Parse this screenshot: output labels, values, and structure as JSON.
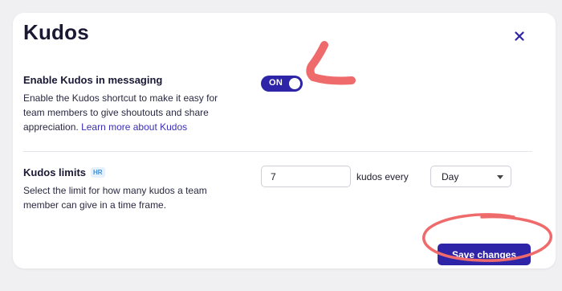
{
  "modal": {
    "title": "Kudos",
    "close_icon": "close-icon"
  },
  "messaging": {
    "heading": "Enable Kudos in messaging",
    "description": "Enable the Kudos shortcut to make it easy for team members to give shoutouts and share appreciation.",
    "link": "Learn more about Kudos",
    "toggle_label": "ON",
    "toggle_on": true
  },
  "limits": {
    "heading": "Kudos limits",
    "badge": "HR",
    "description": "Select the limit for how many kudos a team member can give in a time frame.",
    "count_value": "7",
    "every_label": "kudos every",
    "period_value": "Day"
  },
  "actions": {
    "save_label": "Save changes"
  },
  "colors": {
    "accent": "#2e24a8",
    "annotation": "#ef6a6a"
  }
}
